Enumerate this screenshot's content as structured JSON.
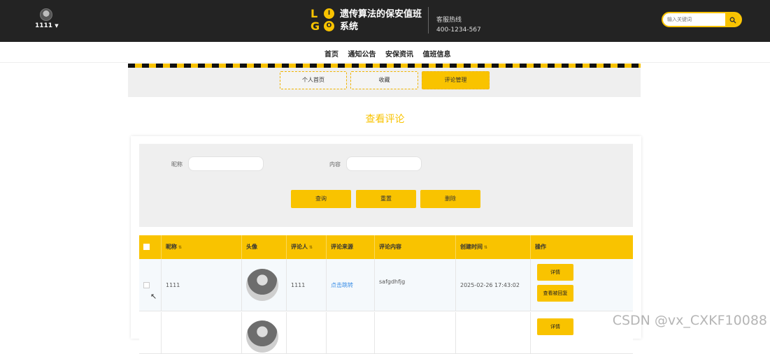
{
  "header": {
    "username": "1111",
    "site_name": "遗传算法的保安值班系统",
    "logo_letters": [
      "L",
      "I",
      "G",
      "O"
    ],
    "hotline_label": "客服热线",
    "hotline_number": "400-1234-567",
    "search_placeholder": "输入关键词"
  },
  "nav": {
    "items": [
      "首页",
      "通知公告",
      "安保资讯",
      "值班信息"
    ]
  },
  "tabs": [
    {
      "label": "个人首页",
      "active": false
    },
    {
      "label": "收藏",
      "active": false
    },
    {
      "label": "评论管理",
      "active": true
    }
  ],
  "page_title": "查看评论",
  "filter": {
    "nickname_label": "昵称",
    "nickname_value": "",
    "content_label": "内容",
    "content_value": "",
    "buttons": {
      "query": "查询",
      "reset": "重置",
      "delete": "删除"
    }
  },
  "table": {
    "columns": [
      "昵称",
      "头像",
      "评论人",
      "评论来源",
      "评论内容",
      "创建时间",
      "操作"
    ],
    "rows": [
      {
        "nickname": "1111",
        "commenter": "1111",
        "source": "点击跳转",
        "content": "safgdhfjg",
        "created": "2025-02-26 17:43:02",
        "actions": [
          "详情",
          "查看被回复"
        ]
      },
      {
        "nickname": "",
        "commenter": "",
        "source": "",
        "content": "",
        "created": "",
        "actions": [
          "详情"
        ]
      }
    ]
  },
  "watermark": "CSDN @vx_CXKF10088",
  "colors": {
    "accent": "#f9c300",
    "header_bg": "#232323",
    "link": "#3a8ee6"
  }
}
